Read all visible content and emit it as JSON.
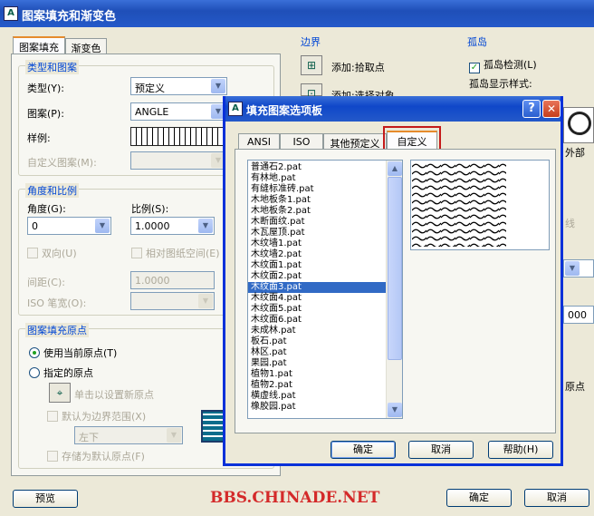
{
  "main_dialog": {
    "title": "图案填充和渐变色",
    "app_icon_glyph": "A",
    "tabs": [
      "图案填充",
      "渐变色"
    ],
    "type_pattern": {
      "group": "类型和图案",
      "type_label": "类型(Y):",
      "type_value": "预定义",
      "pattern_label": "图案(P):",
      "pattern_value": "ANGLE",
      "swatch_label": "样例:",
      "custom_label": "自定义图案(M):"
    },
    "angle_scale": {
      "group": "角度和比例",
      "angle_label": "角度(G):",
      "angle_value": "0",
      "scale_label": "比例(S):",
      "scale_value": "1.0000",
      "double_label": "双向(U)",
      "relative_label": "相对图纸空间(E)",
      "spacing_label": "间距(C):",
      "spacing_value": "1.0000",
      "iso_label": "ISO 笔宽(O):"
    },
    "origin": {
      "group": "图案填充原点",
      "use_current": "使用当前原点(T)",
      "specified": "指定的原点",
      "click_set": "单击以设置新原点",
      "default_extent": "默认为边界范围(X)",
      "position_value": "左下",
      "store_default": "存储为默认原点(F)"
    },
    "boundary": {
      "group": "边界",
      "add_pick": "添加:拾取点",
      "add_select": "添加:选择对象"
    },
    "island": {
      "group": "孤岛",
      "detect": "孤岛检测(L)",
      "style": "孤岛显示样式:",
      "outer_partial": "外部"
    },
    "right_partials": {
      "line_partial": "线",
      "value_partial": "000",
      "origin_partial": "原点"
    },
    "buttons": {
      "preview": "预览",
      "ok": "确定",
      "cancel": "取消"
    }
  },
  "sub_dialog": {
    "title": "填充图案选项板",
    "tabs": [
      "ANSI",
      "ISO",
      "其他预定义",
      "自定义"
    ],
    "active_tab": "自定义",
    "files": [
      "普通石2.pat",
      "有林地.pat",
      "有缝标准砖.pat",
      "木地板条1.pat",
      "木地板条2.pat",
      "木断面纹.pat",
      "木瓦屋顶.pat",
      "木纹墙1.pat",
      "木纹墙2.pat",
      "木纹面1.pat",
      "木纹面2.pat",
      "木纹面3.pat",
      "木纹面4.pat",
      "木纹面5.pat",
      "木纹面6.pat",
      "未成林.pat",
      "板石.pat",
      "林区.pat",
      "果园.pat",
      "植物1.pat",
      "植物2.pat",
      "横虚线.pat",
      "橡胶园.pat"
    ],
    "selected_index": 11,
    "buttons": {
      "ok": "确定",
      "cancel": "取消",
      "help": "帮助(H)"
    },
    "help_glyph": "?",
    "close_glyph": "✕"
  },
  "watermark": "BBS.CHINADE.NET",
  "colors": {
    "title_blue": "#2459c9",
    "group_label": "#0046d5",
    "highlight_red": "#c41a1a",
    "watermark_red": "#d42a2a",
    "selection": "#316ac5"
  }
}
